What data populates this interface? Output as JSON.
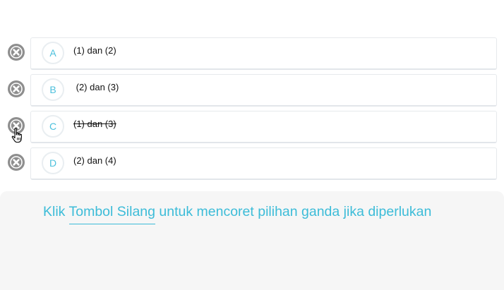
{
  "options": [
    {
      "letter": "A",
      "text": "(1) dan (2)",
      "struck": false
    },
    {
      "letter": "B",
      "text": " (2) dan (3)",
      "struck": false
    },
    {
      "letter": "C",
      "text": "(1) dan (3)",
      "struck": true
    },
    {
      "letter": "D",
      "text": "(2) dan (4)",
      "struck": false
    }
  ],
  "hint": {
    "prefix": "Klik ",
    "highlight": "Tombol Silang",
    "suffix": " untuk mencoret pilihan ganda jika diperlukan"
  },
  "icons": {
    "cross_button": "cross-circle-icon",
    "cursor": "hand-pointer-icon"
  },
  "colors": {
    "accent": "#3cbcd8",
    "cross_button": "#8e8e8e",
    "panel_background": "#f6f6f6"
  }
}
